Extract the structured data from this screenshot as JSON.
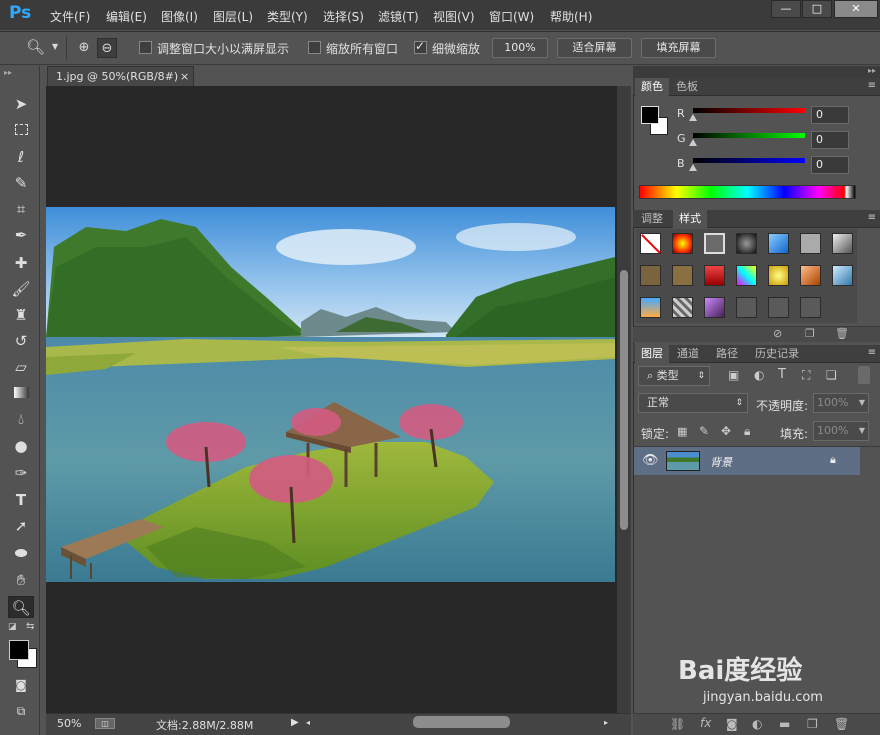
{
  "app": {
    "logo": "Ps"
  },
  "menu": [
    "文件(F)",
    "编辑(E)",
    "图像(I)",
    "图层(L)",
    "类型(Y)",
    "选择(S)",
    "滤镜(T)",
    "视图(V)",
    "窗口(W)",
    "帮助(H)"
  ],
  "window_controls": {
    "minimize": "—",
    "maximize": "□",
    "close": "✕"
  },
  "options": {
    "resize_windows": "调整窗口大小以满屏显示",
    "zoom_all": "缩放所有窗口",
    "scrubby_zoom": "细微缩放",
    "pct_100": "100%",
    "fit_screen": "适合屏幕",
    "fill_screen": "填充屏幕"
  },
  "document": {
    "tab_label": "1.jpg @ 50%(RGB/8#)",
    "close": "×"
  },
  "status": {
    "zoom": "50%",
    "doc_size": "文档:2.88M/2.88M"
  },
  "color_panel": {
    "tabs": [
      "颜色",
      "色板"
    ],
    "r_label": "R",
    "g_label": "G",
    "b_label": "B",
    "r": "0",
    "g": "0",
    "b": "0"
  },
  "styles_panel": {
    "tabs": [
      "调整",
      "样式"
    ]
  },
  "layers_panel": {
    "tabs": [
      "图层",
      "通道",
      "路径",
      "历史记录"
    ],
    "filter": "类型",
    "blend_mode": "正常",
    "opacity_label": "不透明度:",
    "opacity_value": "100%",
    "lock_label": "锁定:",
    "fill_label": "填充:",
    "fill_value": "100%",
    "layer_name": "背景"
  },
  "watermark": {
    "text": "Bai度经验",
    "url": "jingyan.baidu.com"
  },
  "colors": {
    "ps_blue": "#31a8ff",
    "panel_bg": "#535353",
    "canvas_bg": "#282828",
    "selected_layer": "#5e6e85"
  }
}
